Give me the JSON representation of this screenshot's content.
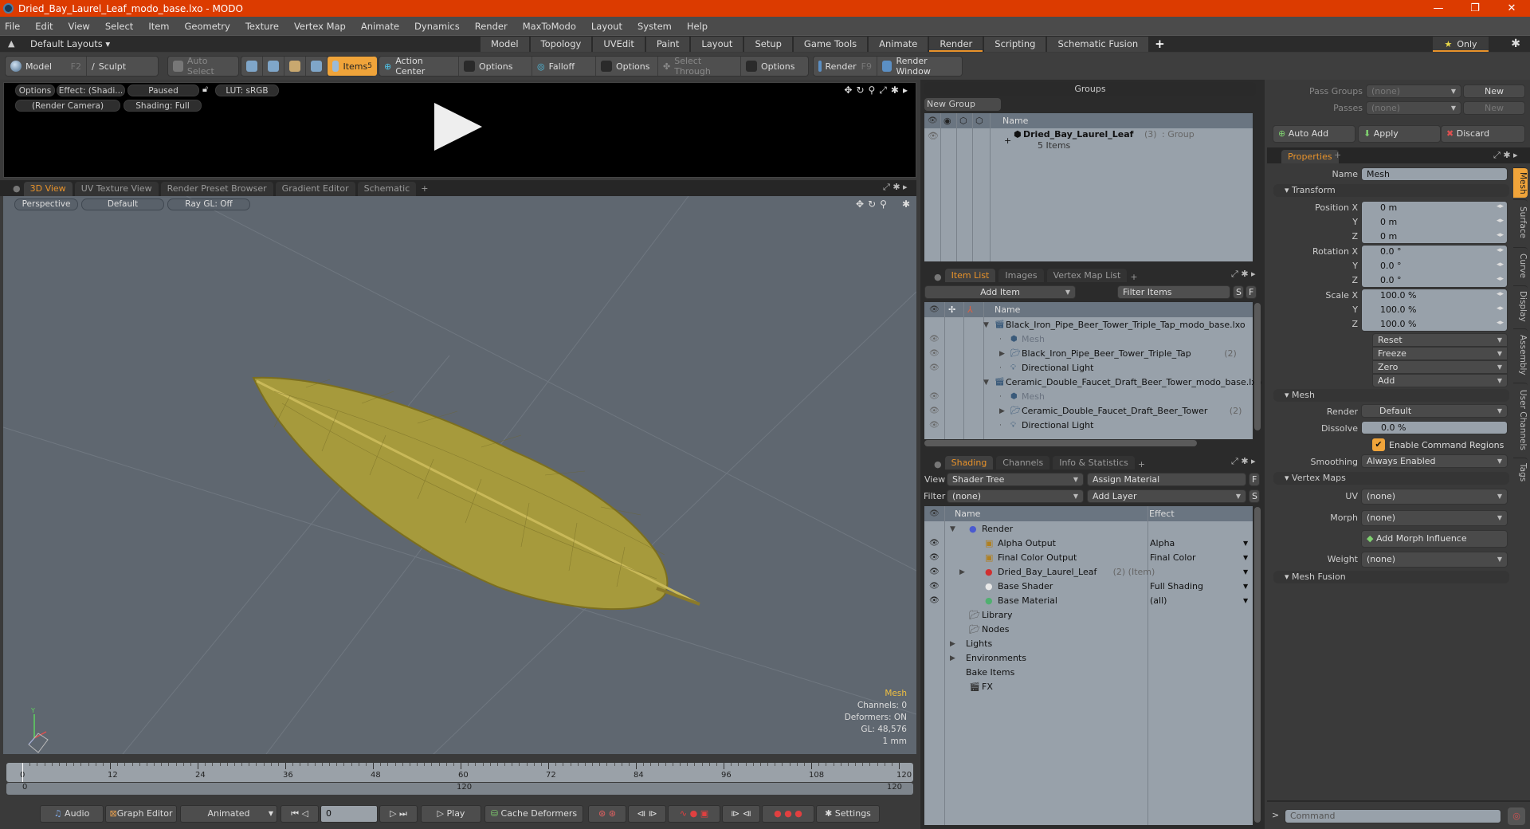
{
  "window": {
    "title": "Dried_Bay_Laurel_Leaf_modo_base.lxo - MODO",
    "controls": [
      "—",
      "❐",
      "✕"
    ]
  },
  "menubar": [
    "File",
    "Edit",
    "View",
    "Select",
    "Item",
    "Geometry",
    "Texture",
    "Vertex Map",
    "Animate",
    "Dynamics",
    "Render",
    "MaxToModo",
    "Layout",
    "System",
    "Help"
  ],
  "layoutbar": {
    "layouts_label": "Default Layouts ▾",
    "tabs": [
      "Model",
      "Topology",
      "UVEdit",
      "Paint",
      "Layout",
      "Setup",
      "Game Tools",
      "Animate",
      "Render",
      "Scripting",
      "Schematic Fusion"
    ],
    "active_tab": "Render",
    "add": "+",
    "only_label": "Only"
  },
  "toolbar": {
    "model": "Model",
    "model_key": "F2",
    "sculpt": "Sculpt",
    "auto_select": "Auto Select",
    "items": "Items",
    "items_key": "5",
    "action_center": "Action Center",
    "options1": "Options",
    "falloff": "Falloff",
    "options2": "Options",
    "select_through": "Select Through",
    "options3": "Options",
    "render": "Render",
    "render_key": "F9",
    "render_window": "Render Window"
  },
  "render_preview": {
    "options": "Options",
    "effect": "Effect: (Shadi...",
    "paused": "Paused",
    "lut": "LUT: sRGB",
    "camera": "(Render Camera)",
    "shading": "Shading: Full"
  },
  "viewport_tabs": {
    "tabs": [
      "3D View",
      "UV Texture View",
      "Render Preset Browser",
      "Gradient Editor",
      "Schematic"
    ],
    "active": "3D View",
    "add": "+"
  },
  "viewport": {
    "projection": "Perspective",
    "style": "Default",
    "raygl": "Ray GL: Off",
    "hud": {
      "title": "Mesh",
      "channels": "Channels: 0",
      "deformers": "Deformers: ON",
      "gl": "GL: 48,576",
      "unit": "1 mm"
    },
    "axis": {
      "y": "Y"
    }
  },
  "timeline": {
    "ticks": [
      "0",
      "12",
      "24",
      "36",
      "48",
      "60",
      "72",
      "84",
      "96",
      "108",
      "120"
    ],
    "range_start": "0",
    "range_mid": "120",
    "range_end": "120"
  },
  "bottombar": {
    "audio": "Audio",
    "graph_editor": "Graph Editor",
    "animated": "Animated",
    "frame": "0",
    "play": "Play",
    "cache_deformers": "Cache Deformers",
    "settings": "Settings"
  },
  "groups": {
    "title": "Groups",
    "new_group": "New Group",
    "name_col": "Name",
    "rows": [
      {
        "name": "Dried_Bay_Laurel_Leaf",
        "count": "(3)",
        "type": ": Group",
        "sub": "5 Items"
      }
    ]
  },
  "itemlist": {
    "tabs": [
      "Item List",
      "Images",
      "Vertex Map List"
    ],
    "active": "Item List",
    "add_item": "Add Item",
    "filter_placeholder": "Filter Items",
    "s": "S",
    "f": "F",
    "name_col": "Name",
    "rows": [
      {
        "name": "Black_Iron_Pipe_Beer_Tower_Triple_Tap_modo_base.lxo",
        "count": "",
        "level": 0,
        "kind": "scene",
        "eye": false
      },
      {
        "name": "Mesh",
        "count": "",
        "level": 1,
        "kind": "mesh",
        "eye": true,
        "dim": true
      },
      {
        "name": "Black_Iron_Pipe_Beer_Tower_Triple_Tap",
        "count": "(2)",
        "level": 1,
        "kind": "group",
        "eye": true
      },
      {
        "name": "Directional Light",
        "count": "",
        "level": 1,
        "kind": "light",
        "eye": true
      },
      {
        "name": "Ceramic_Double_Faucet_Draft_Beer_Tower_modo_base.lxo",
        "count": "",
        "level": 0,
        "kind": "scene",
        "eye": false
      },
      {
        "name": "Mesh",
        "count": "",
        "level": 1,
        "kind": "mesh",
        "eye": true,
        "dim": true
      },
      {
        "name": "Ceramic_Double_Faucet_Draft_Beer_Tower",
        "count": "(2)",
        "level": 1,
        "kind": "group",
        "eye": true
      },
      {
        "name": "Directional Light",
        "count": "",
        "level": 1,
        "kind": "light",
        "eye": true
      }
    ]
  },
  "shading": {
    "tabs": [
      "Shading",
      "Channels",
      "Info & Statistics"
    ],
    "active": "Shading",
    "view_label": "View",
    "view_value": "Shader Tree",
    "assign_material": "Assign Material",
    "filter_label": "Filter",
    "filter_value": "(none)",
    "add_layer": "Add Layer",
    "f": "F",
    "s": "S",
    "name_col": "Name",
    "effect_col": "Effect",
    "rows": [
      {
        "name": "Render",
        "effect": "",
        "level": 0,
        "eye": false,
        "extra": ""
      },
      {
        "name": "Alpha Output",
        "effect": "Alpha",
        "level": 1,
        "eye": true,
        "extra": ""
      },
      {
        "name": "Final Color Output",
        "effect": "Final Color",
        "level": 1,
        "eye": true,
        "extra": ""
      },
      {
        "name": "Dried_Bay_Laurel_Leaf",
        "effect": "",
        "level": 1,
        "eye": true,
        "extra": "(2) (Item)"
      },
      {
        "name": "Base Shader",
        "effect": "Full Shading",
        "level": 1,
        "eye": true,
        "extra": ""
      },
      {
        "name": "Base Material",
        "effect": "(all)",
        "level": 1,
        "eye": true,
        "extra": ""
      },
      {
        "name": "Library",
        "effect": "",
        "level": 0,
        "eye": false,
        "extra": ""
      },
      {
        "name": "Nodes",
        "effect": "",
        "level": 0,
        "eye": false,
        "extra": ""
      },
      {
        "name": "Lights",
        "effect": "",
        "level": -1,
        "eye": false,
        "extra": ""
      },
      {
        "name": "Environments",
        "effect": "",
        "level": -1,
        "eye": false,
        "extra": ""
      },
      {
        "name": "Bake Items",
        "effect": "",
        "level": -1,
        "eye": false,
        "extra": ""
      },
      {
        "name": "FX",
        "effect": "",
        "level": 0,
        "eye": false,
        "extra": ""
      }
    ]
  },
  "passes": {
    "pass_groups_label": "Pass Groups",
    "pass_groups_value": "(none)",
    "new1": "New",
    "passes_label": "Passes",
    "passes_value": "(none)",
    "new2": "New",
    "auto_add": "Auto Add",
    "apply": "Apply",
    "discard": "Discard"
  },
  "properties": {
    "tab": "Properties",
    "name_label": "Name",
    "name_value": "Mesh",
    "transform": "Transform",
    "position": [
      {
        "label": "Position X",
        "value": "0 m"
      },
      {
        "label": "Y",
        "value": "0 m"
      },
      {
        "label": "Z",
        "value": "0 m"
      }
    ],
    "rotation": [
      {
        "label": "Rotation X",
        "value": "0.0 °"
      },
      {
        "label": "Y",
        "value": "0.0 °"
      },
      {
        "label": "Z",
        "value": "0.0 °"
      }
    ],
    "scale": [
      {
        "label": "Scale X",
        "value": "100.0 %"
      },
      {
        "label": "Y",
        "value": "100.0 %"
      },
      {
        "label": "Z",
        "value": "100.0 %"
      }
    ],
    "actions": [
      "Reset",
      "Freeze",
      "Zero",
      "Add"
    ],
    "mesh": "Mesh",
    "render_label": "Render",
    "render_value": "Default",
    "dissolve_label": "Dissolve",
    "dissolve_value": "0.0 %",
    "enable_cmd_regions": "Enable Command Regions",
    "enable_cmd_regions_checked": true,
    "smoothing_label": "Smoothing",
    "smoothing_value": "Always Enabled",
    "vertex_maps": "Vertex Maps",
    "uv_label": "UV",
    "uv_value": "(none)",
    "morph_label": "Morph",
    "morph_value": "(none)",
    "add_morph": "Add Morph Influence",
    "weight_label": "Weight",
    "weight_value": "(none)",
    "mesh_fusion": "Mesh Fusion",
    "side_tabs": [
      "Mesh",
      "Surface",
      "Curve",
      "Display",
      "Assembly",
      "User Channels",
      "Tags"
    ]
  },
  "command": {
    "placeholder": "Command",
    "prompt": ">"
  }
}
